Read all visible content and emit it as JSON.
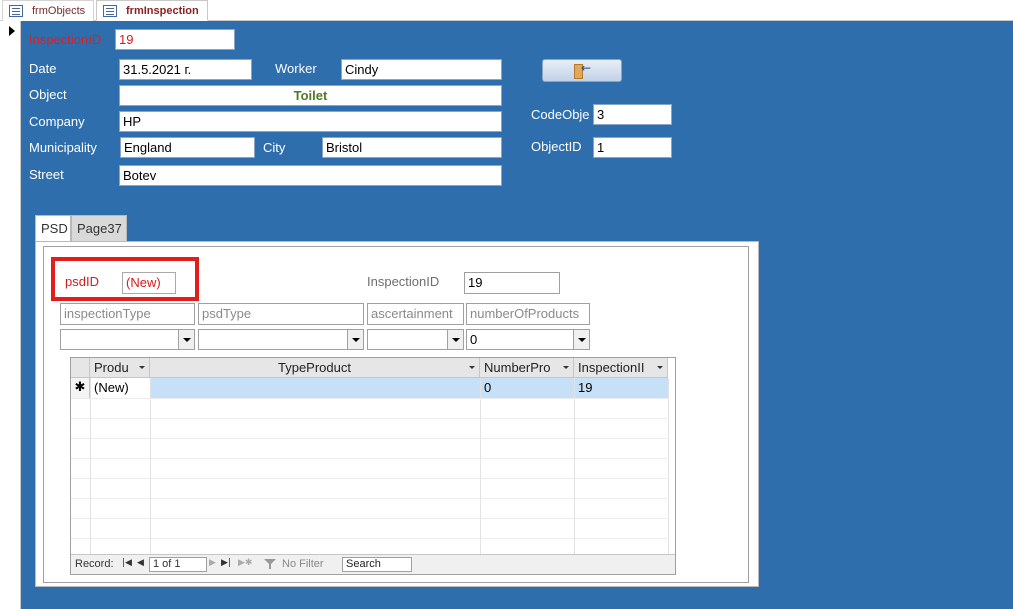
{
  "doc_tabs": [
    {
      "label": "frmObjects"
    },
    {
      "label": "frmInspection"
    }
  ],
  "form": {
    "inspection_id_label": "InspectionID",
    "inspection_id_value": "19",
    "date_label": "Date",
    "date_value": "31.5.2021 г.",
    "worker_label": "Worker",
    "worker_value": "Cindy",
    "object_label": "Object",
    "object_value": "Toilet",
    "company_label": "Company",
    "company_value": "HP",
    "municipality_label": "Municipality",
    "municipality_value": "England",
    "city_label": "City",
    "city_value": "Bristol",
    "street_label": "Street",
    "street_value": "Botev",
    "code_object_label": "CodeObje",
    "code_object_value": "3",
    "object_id_label": "ObjectID",
    "object_id_value": "1"
  },
  "tabs": [
    {
      "label": "PSD"
    },
    {
      "label": "Page37"
    }
  ],
  "subform": {
    "psd_id_label": "psdID",
    "psd_id_value": "(New)",
    "inspection_id_label": "InspectionID",
    "inspection_id_value": "19",
    "placeholders": {
      "inspection_type": "inspectionType",
      "psd_type": "psdType",
      "ascertainment": "ascertainment",
      "number_of_products": "numberOfProducts"
    },
    "combo_values": {
      "number_of_products": "0"
    }
  },
  "datasheet": {
    "columns": [
      {
        "label": "Produ"
      },
      {
        "label": "TypeProduct"
      },
      {
        "label": "NumberPro"
      },
      {
        "label": "InspectionII"
      }
    ],
    "new_row": {
      "selector": "✱",
      "product": "(New)",
      "type_product": "",
      "number_products": "0",
      "inspection_id": "19"
    }
  },
  "navbar": {
    "record_label": "Record:",
    "record_value": "1 of 1",
    "filter_label": "No Filter",
    "search_label": "Search",
    "first_icon": "first-record-icon",
    "prev_icon": "prev-record-icon",
    "next_icon": "next-record-icon",
    "last_icon": "last-record-icon",
    "new_icon": "new-record-icon"
  },
  "colors": {
    "form_background": "#2e6ead",
    "accent_red": "#e31c1c",
    "object_text": "#4e7a23"
  }
}
